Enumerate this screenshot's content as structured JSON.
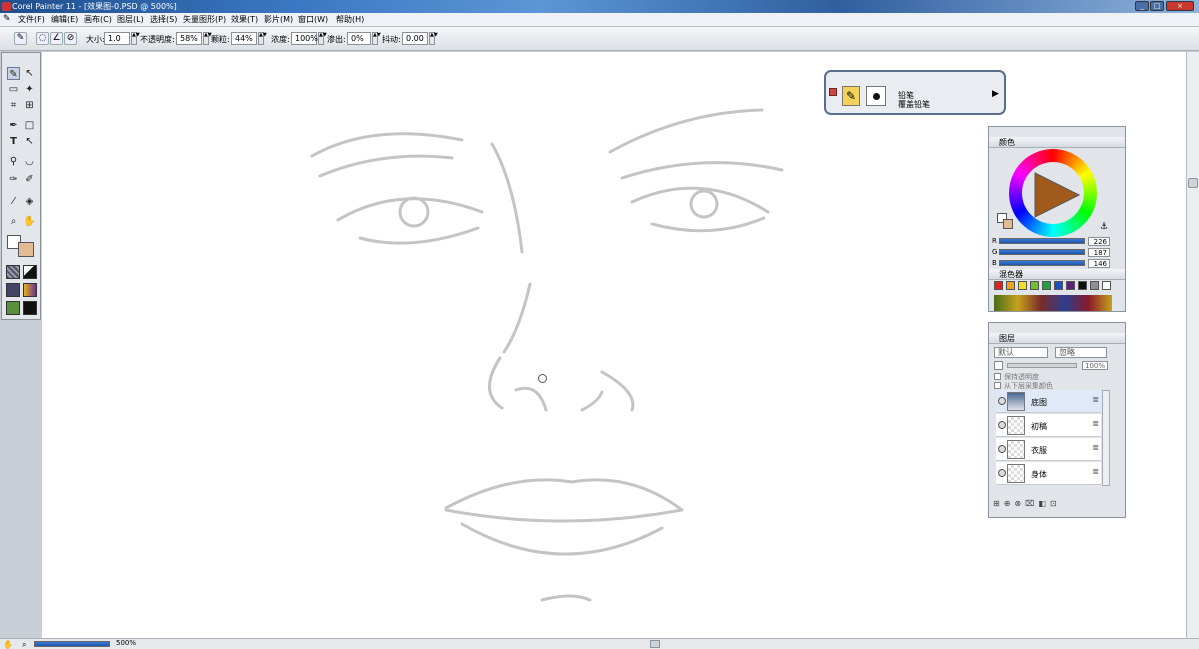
{
  "window": {
    "title": "Corel Painter 11 - [效果图-0.PSD @ 500%]",
    "buttons": [
      "_",
      "□",
      "×"
    ]
  },
  "menu": [
    "文件(F)",
    "编辑(E)",
    "画布(C)",
    "图层(L)",
    "选择(S)",
    "矢量图形(P)",
    "效果(T)",
    "影片(M)",
    "窗口(W)",
    "帮助(H)"
  ],
  "property_bar": {
    "size_label": "大小:",
    "size_value": "1.0",
    "opacity_label": "不透明度:",
    "opacity_value": "58%",
    "grain_label": "颗粒:",
    "grain_value": "44%",
    "density_label": "浓度:",
    "density_value": "100%",
    "bleed_label": "渗出:",
    "bleed_value": "0%",
    "jitter_label": "抖动:",
    "jitter_value": "0.00"
  },
  "brush_selector": {
    "category": "铅笔",
    "variant": "覆盖铅笔"
  },
  "colors_panel": {
    "title": "颜色",
    "r_label": "R",
    "r_value": "226",
    "g_label": "G",
    "g_value": "187",
    "b_label": "B",
    "b_value": "146",
    "main_color": "#e2bb92"
  },
  "mixer_panel": {
    "title": "混色器",
    "swatches": [
      "#e02020",
      "#f0a020",
      "#f0e020",
      "#70c030",
      "#20a040",
      "#2050c0",
      "#602080",
      "#101010",
      "#909090",
      "#ffffff"
    ]
  },
  "layers_panel": {
    "title": "图层",
    "composite_method": "默认",
    "depth": "忽略",
    "opacity": "100%",
    "preserve_transparency": "保持透明度",
    "pick_up_color": "从下层采集颜色",
    "layers": [
      {
        "name": "底图"
      },
      {
        "name": "初稿"
      },
      {
        "name": "衣服"
      },
      {
        "name": "身体"
      }
    ]
  },
  "status": {
    "zoom": "500%"
  }
}
